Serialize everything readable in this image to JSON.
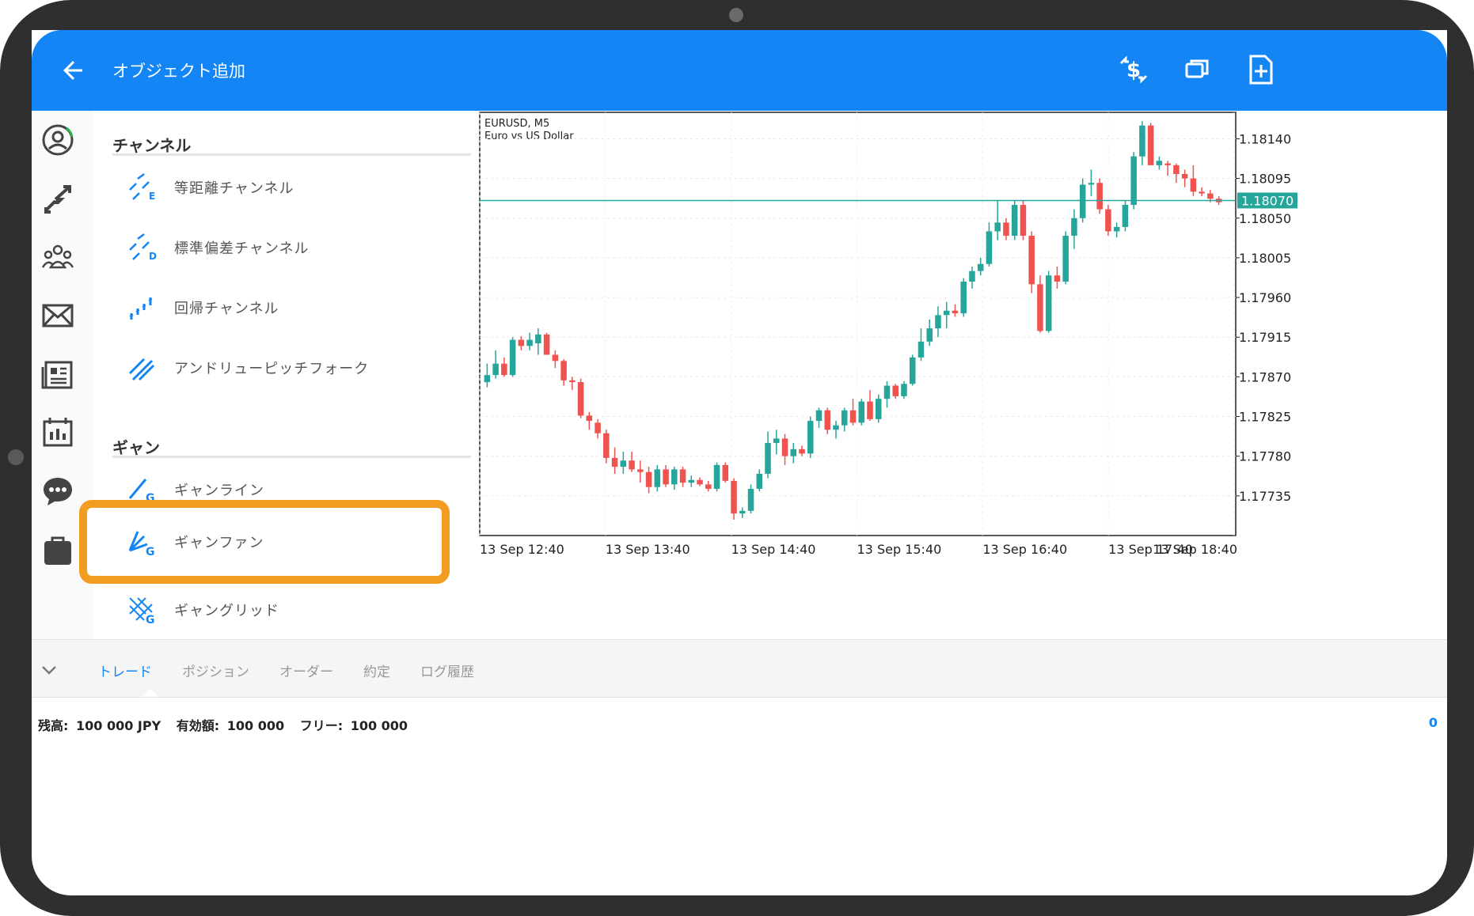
{
  "appbar": {
    "title": "オブジェクト追加"
  },
  "sections": [
    {
      "title": "チャンネル",
      "items": [
        {
          "label": "等距離チャンネル",
          "icon": "equidistant-channel-icon"
        },
        {
          "label": "標準偏差チャンネル",
          "icon": "stddev-channel-icon"
        },
        {
          "label": "回帰チャンネル",
          "icon": "regression-channel-icon"
        },
        {
          "label": "アンドリューピッチフォーク",
          "icon": "andrews-pitchfork-icon"
        }
      ]
    },
    {
      "title": "ギャン",
      "items": [
        {
          "label": "ギャンライン",
          "icon": "gann-line-icon"
        },
        {
          "label": "ギャンファン",
          "icon": "gann-fan-icon",
          "highlighted": true
        },
        {
          "label": "ギャングリッド",
          "icon": "gann-grid-icon"
        }
      ]
    }
  ],
  "colors": {
    "accent": "#1485f5",
    "highlight": "#f39c22",
    "bull": "#26a69a",
    "bear": "#ef5350",
    "priceline": "#26a69a"
  },
  "chart_data": {
    "type": "candlestick",
    "symbol": "EURUSD, M5",
    "description": "Euro vs US Dollar",
    "current_price": "1.18070",
    "ylim": [
      1.1769,
      1.1817
    ],
    "y_ticks": [
      "1.18140",
      "1.18095",
      "1.18050",
      "1.18005",
      "1.17960",
      "1.17915",
      "1.17870",
      "1.17825",
      "1.17780",
      "1.17735"
    ],
    "y_tick_values": [
      1.1814,
      1.18095,
      1.1805,
      1.18005,
      1.1796,
      1.17915,
      1.1787,
      1.17825,
      1.1778,
      1.17735
    ],
    "x_ticks": [
      "13 Sep 12:40",
      "13 Sep 13:40",
      "13 Sep 14:40",
      "13 Sep 15:40",
      "13 Sep 16:40",
      "13 Sep 17:40",
      "13 Sep 18:40"
    ],
    "candles": [
      {
        "o": 1.17864,
        "h": 1.17885,
        "l": 1.17858,
        "c": 1.17872
      },
      {
        "o": 1.17872,
        "h": 1.179,
        "l": 1.17868,
        "c": 1.17885
      },
      {
        "o": 1.17885,
        "h": 1.17892,
        "l": 1.1787,
        "c": 1.17872
      },
      {
        "o": 1.17872,
        "h": 1.17915,
        "l": 1.1787,
        "c": 1.17912
      },
      {
        "o": 1.17912,
        "h": 1.17916,
        "l": 1.179,
        "c": 1.17905
      },
      {
        "o": 1.17905,
        "h": 1.1792,
        "l": 1.179,
        "c": 1.17912
      },
      {
        "o": 1.17908,
        "h": 1.17925,
        "l": 1.17895,
        "c": 1.17918
      },
      {
        "o": 1.17918,
        "h": 1.1792,
        "l": 1.17895,
        "c": 1.17895
      },
      {
        "o": 1.17895,
        "h": 1.179,
        "l": 1.1788,
        "c": 1.17888
      },
      {
        "o": 1.17888,
        "h": 1.1789,
        "l": 1.1786,
        "c": 1.17866
      },
      {
        "o": 1.17866,
        "h": 1.1787,
        "l": 1.17855,
        "c": 1.17864
      },
      {
        "o": 1.17864,
        "h": 1.17868,
        "l": 1.17823,
        "c": 1.17826
      },
      {
        "o": 1.17826,
        "h": 1.1783,
        "l": 1.1781,
        "c": 1.1782
      },
      {
        "o": 1.17818,
        "h": 1.17822,
        "l": 1.178,
        "c": 1.17806
      },
      {
        "o": 1.17806,
        "h": 1.1781,
        "l": 1.17772,
        "c": 1.17778
      },
      {
        "o": 1.17778,
        "h": 1.1779,
        "l": 1.1776,
        "c": 1.17768
      },
      {
        "o": 1.17768,
        "h": 1.17785,
        "l": 1.1776,
        "c": 1.17775
      },
      {
        "o": 1.17775,
        "h": 1.17785,
        "l": 1.17762,
        "c": 1.17765
      },
      {
        "o": 1.17765,
        "h": 1.17775,
        "l": 1.1775,
        "c": 1.17762
      },
      {
        "o": 1.17762,
        "h": 1.17768,
        "l": 1.17738,
        "c": 1.17745
      },
      {
        "o": 1.17745,
        "h": 1.1777,
        "l": 1.1774,
        "c": 1.17765
      },
      {
        "o": 1.17765,
        "h": 1.1777,
        "l": 1.17745,
        "c": 1.17748
      },
      {
        "o": 1.17748,
        "h": 1.17768,
        "l": 1.17742,
        "c": 1.17765
      },
      {
        "o": 1.17765,
        "h": 1.17768,
        "l": 1.17745,
        "c": 1.1775
      },
      {
        "o": 1.1775,
        "h": 1.17758,
        "l": 1.17745,
        "c": 1.17753
      },
      {
        "o": 1.17753,
        "h": 1.17756,
        "l": 1.17746,
        "c": 1.17748
      },
      {
        "o": 1.17748,
        "h": 1.17752,
        "l": 1.1774,
        "c": 1.17743
      },
      {
        "o": 1.17743,
        "h": 1.17773,
        "l": 1.1774,
        "c": 1.1777
      },
      {
        "o": 1.1777,
        "h": 1.17773,
        "l": 1.1775,
        "c": 1.17752
      },
      {
        "o": 1.17752,
        "h": 1.17755,
        "l": 1.17708,
        "c": 1.17715
      },
      {
        "o": 1.17715,
        "h": 1.17722,
        "l": 1.1771,
        "c": 1.17718
      },
      {
        "o": 1.17718,
        "h": 1.17748,
        "l": 1.17715,
        "c": 1.17743
      },
      {
        "o": 1.17743,
        "h": 1.17765,
        "l": 1.1774,
        "c": 1.1776
      },
      {
        "o": 1.1776,
        "h": 1.17808,
        "l": 1.17755,
        "c": 1.17795
      },
      {
        "o": 1.17795,
        "h": 1.1781,
        "l": 1.17782,
        "c": 1.178
      },
      {
        "o": 1.178,
        "h": 1.17805,
        "l": 1.1777,
        "c": 1.1778
      },
      {
        "o": 1.1778,
        "h": 1.17795,
        "l": 1.17772,
        "c": 1.17788
      },
      {
        "o": 1.17788,
        "h": 1.17792,
        "l": 1.1778,
        "c": 1.17783
      },
      {
        "o": 1.17783,
        "h": 1.17825,
        "l": 1.17778,
        "c": 1.1782
      },
      {
        "o": 1.1782,
        "h": 1.17835,
        "l": 1.17812,
        "c": 1.17832
      },
      {
        "o": 1.17832,
        "h": 1.17835,
        "l": 1.17805,
        "c": 1.1781
      },
      {
        "o": 1.1781,
        "h": 1.1782,
        "l": 1.178,
        "c": 1.17815
      },
      {
        "o": 1.17815,
        "h": 1.17835,
        "l": 1.17808,
        "c": 1.17832
      },
      {
        "o": 1.17832,
        "h": 1.17845,
        "l": 1.17815,
        "c": 1.17818
      },
      {
        "o": 1.17818,
        "h": 1.17845,
        "l": 1.17815,
        "c": 1.17842
      },
      {
        "o": 1.17842,
        "h": 1.17855,
        "l": 1.1782,
        "c": 1.17822
      },
      {
        "o": 1.17822,
        "h": 1.1785,
        "l": 1.17818,
        "c": 1.17845
      },
      {
        "o": 1.17845,
        "h": 1.17865,
        "l": 1.17835,
        "c": 1.1786
      },
      {
        "o": 1.1786,
        "h": 1.17862,
        "l": 1.17845,
        "c": 1.17848
      },
      {
        "o": 1.17848,
        "h": 1.17865,
        "l": 1.17845,
        "c": 1.17862
      },
      {
        "o": 1.17862,
        "h": 1.17895,
        "l": 1.1786,
        "c": 1.17892
      },
      {
        "o": 1.17892,
        "h": 1.17925,
        "l": 1.17888,
        "c": 1.1791
      },
      {
        "o": 1.1791,
        "h": 1.17935,
        "l": 1.17905,
        "c": 1.17925
      },
      {
        "o": 1.17925,
        "h": 1.1795,
        "l": 1.17915,
        "c": 1.1794
      },
      {
        "o": 1.1794,
        "h": 1.17955,
        "l": 1.17925,
        "c": 1.17945
      },
      {
        "o": 1.17945,
        "h": 1.17952,
        "l": 1.17938,
        "c": 1.17942
      },
      {
        "o": 1.17942,
        "h": 1.17982,
        "l": 1.17938,
        "c": 1.17978
      },
      {
        "o": 1.17978,
        "h": 1.17995,
        "l": 1.1797,
        "c": 1.1799
      },
      {
        "o": 1.1799,
        "h": 1.18005,
        "l": 1.17985,
        "c": 1.17998
      },
      {
        "o": 1.17998,
        "h": 1.18045,
        "l": 1.17995,
        "c": 1.18035
      },
      {
        "o": 1.18035,
        "h": 1.1807,
        "l": 1.18025,
        "c": 1.18045
      },
      {
        "o": 1.18045,
        "h": 1.1805,
        "l": 1.18025,
        "c": 1.1803
      },
      {
        "o": 1.1803,
        "h": 1.1807,
        "l": 1.18025,
        "c": 1.18065
      },
      {
        "o": 1.18065,
        "h": 1.1807,
        "l": 1.18025,
        "c": 1.1803
      },
      {
        "o": 1.1803,
        "h": 1.18035,
        "l": 1.17965,
        "c": 1.17975
      },
      {
        "o": 1.17975,
        "h": 1.17985,
        "l": 1.1792,
        "c": 1.17922
      },
      {
        "o": 1.17922,
        "h": 1.1799,
        "l": 1.1792,
        "c": 1.17985
      },
      {
        "o": 1.17985,
        "h": 1.17995,
        "l": 1.1797,
        "c": 1.17978
      },
      {
        "o": 1.17978,
        "h": 1.18035,
        "l": 1.17975,
        "c": 1.1803
      },
      {
        "o": 1.1803,
        "h": 1.1806,
        "l": 1.18015,
        "c": 1.1805
      },
      {
        "o": 1.1805,
        "h": 1.18095,
        "l": 1.18045,
        "c": 1.18088
      },
      {
        "o": 1.18088,
        "h": 1.18105,
        "l": 1.18075,
        "c": 1.1809
      },
      {
        "o": 1.1809,
        "h": 1.18095,
        "l": 1.18055,
        "c": 1.1806
      },
      {
        "o": 1.1806,
        "h": 1.18065,
        "l": 1.1803,
        "c": 1.18035
      },
      {
        "o": 1.18035,
        "h": 1.18045,
        "l": 1.18028,
        "c": 1.1804
      },
      {
        "o": 1.1804,
        "h": 1.1807,
        "l": 1.18035,
        "c": 1.18065
      },
      {
        "o": 1.18065,
        "h": 1.18125,
        "l": 1.1806,
        "c": 1.1812
      },
      {
        "o": 1.1812,
        "h": 1.1816,
        "l": 1.1811,
        "c": 1.18155
      },
      {
        "o": 1.18155,
        "h": 1.18158,
        "l": 1.1811,
        "c": 1.1811
      },
      {
        "o": 1.1811,
        "h": 1.1812,
        "l": 1.18105,
        "c": 1.18115
      },
      {
        "o": 1.18112,
        "h": 1.18115,
        "l": 1.18098,
        "c": 1.1811
      },
      {
        "o": 1.1811,
        "h": 1.18112,
        "l": 1.1809,
        "c": 1.181
      },
      {
        "o": 1.181,
        "h": 1.18105,
        "l": 1.18085,
        "c": 1.18095
      },
      {
        "o": 1.18095,
        "h": 1.1811,
        "l": 1.18075,
        "c": 1.1808
      },
      {
        "o": 1.1808,
        "h": 1.18085,
        "l": 1.18075,
        "c": 1.18078
      },
      {
        "o": 1.18078,
        "h": 1.18082,
        "l": 1.18068,
        "c": 1.18072
      },
      {
        "o": 1.18072,
        "h": 1.18075,
        "l": 1.18065,
        "c": 1.18068
      }
    ]
  },
  "bottom": {
    "tabs": [
      "トレード",
      "ポジション",
      "オーダー",
      "約定",
      "ログ履歴"
    ],
    "balance_label": "残高:",
    "balance_value": "100 000 JPY",
    "equity_label": "有効額:",
    "equity_value": "100 000",
    "free_label": "フリー:",
    "free_value": "100 000",
    "right_value": "0"
  }
}
